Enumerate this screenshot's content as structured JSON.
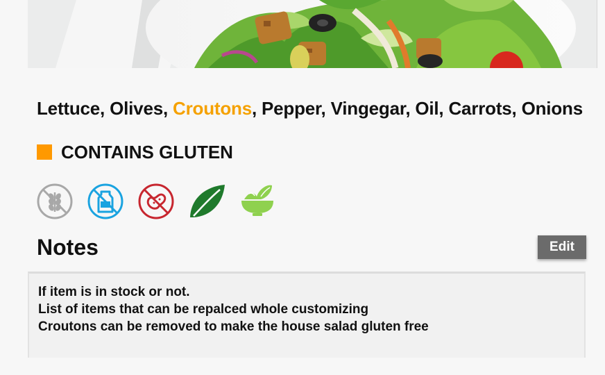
{
  "ingredients": {
    "before": "Lettuce, Olives, ",
    "highlight": "Croutons",
    "after": ", Pepper, Vingegar, Oil, Carrots, Onions",
    "highlight_color": "#f5a100"
  },
  "allergen": {
    "label": "CONTAINS GLUTEN",
    "color": "#ff9900"
  },
  "diet_icons": [
    "gluten-free-icon",
    "dairy-free-icon",
    "nut-free-icon",
    "vegan-leaf-icon",
    "salad-bowl-icon"
  ],
  "notes": {
    "title": "Notes",
    "edit_label": "Edit",
    "lines": [
      "If item is in stock or not.",
      "List of items that can be repalced whole customizing",
      "Croutons can be removed to make the house salad gluten free"
    ]
  }
}
